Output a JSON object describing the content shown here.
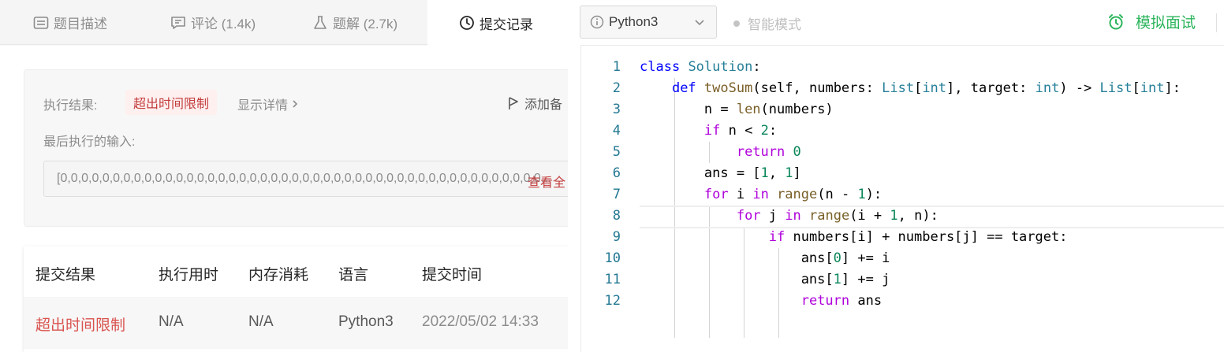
{
  "tabs": [
    {
      "label": "题目描述",
      "icon": "description-icon"
    },
    {
      "label": "评论 (1.4k)",
      "icon": "comment-icon"
    },
    {
      "label": "题解 (2.7k)",
      "icon": "flask-icon"
    },
    {
      "label": "提交记录",
      "icon": "clock-icon",
      "active": true
    }
  ],
  "result": {
    "label": "执行结果:",
    "status": "超出时间限制",
    "details_link": "显示详情",
    "add_note": "添加备",
    "last_input_label": "最后执行的输入:",
    "last_input_value": "[0,0,0,0,0,0,0,0,0,0,0,0,0,0,0,0,0,0,0,0,0,0,0,0,0,0,0,0,0,0,0,0,0,0,0,0,0,0,0,0,0,0,0,0,0,0...",
    "view_all": "查看全"
  },
  "submissions": {
    "headers": [
      "提交结果",
      "执行用时",
      "内存消耗",
      "语言",
      "提交时间"
    ],
    "rows": [
      {
        "status": "超出时间限制",
        "runtime": "N/A",
        "memory": "N/A",
        "language": "Python3",
        "time": "2022/05/02 14:33"
      }
    ]
  },
  "editor": {
    "language": "Python3",
    "smart_mode": "智能模式",
    "mock_interview": "模拟面试",
    "current_line": 8,
    "code_lines": [
      "class Solution:",
      "    def twoSum(self, numbers: List[int], target: int) -> List[int]:",
      "        n = len(numbers)",
      "        if n < 2:",
      "            return 0",
      "        ans = [1, 1]",
      "        for i in range(n - 1):",
      "            for j in range(i + 1, n):",
      "                if numbers[i] + numbers[j] == target:",
      "                    ans[0] += i",
      "                    ans[1] += j",
      "                    return ans"
    ]
  },
  "colors": {
    "accent_green": "#2db55d",
    "error_red": "#c33d3d",
    "keyword_blue": "#0000ff",
    "keyword_purple": "#af00db",
    "type_teal": "#267f99",
    "function_brown": "#795e26",
    "number_green": "#098658"
  }
}
